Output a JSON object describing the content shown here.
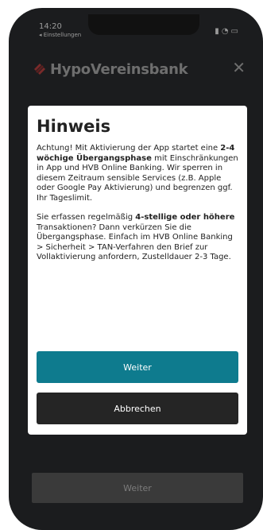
{
  "status_bar": {
    "time": "14:20",
    "subtitle": "◂ Einstellungen",
    "icons": [
      "signal-icon",
      "wifi-icon",
      "battery-icon"
    ]
  },
  "header": {
    "brand": "HypoVereinsbank",
    "close_icon": "close-icon"
  },
  "dialog": {
    "title": "Hinweis",
    "p1_a": "Achtung! Mit Aktivierung der App startet eine ",
    "p1_b": "2-4 wöchige Übergangsphase",
    "p1_c": " mit Einschränkungen in App und HVB Online Banking. Wir sperren in diesem Zeitraum sensible Services (z.B. Apple oder Google Pay Aktivierung) und begrenzen ggf. Ihr Tageslimit.",
    "p2_a": "Sie erfassen regelmäßig ",
    "p2_b": "4-stellige oder höhere",
    "p2_c": " Transaktionen? Dann verkürzen Sie die Übergangsphase. Einfach im HVB Online Banking > Sicherheit > TAN-Verfahren den Brief zur Vollaktivierung anfordern, Zustelldauer 2-3 Tage.",
    "primary_button": "Weiter",
    "secondary_button": "Abbrechen"
  },
  "background": {
    "continue_button": "Weiter"
  },
  "colors": {
    "primary": "#0e7b8e",
    "secondary": "#252525",
    "brand_red": "#c8102e"
  }
}
